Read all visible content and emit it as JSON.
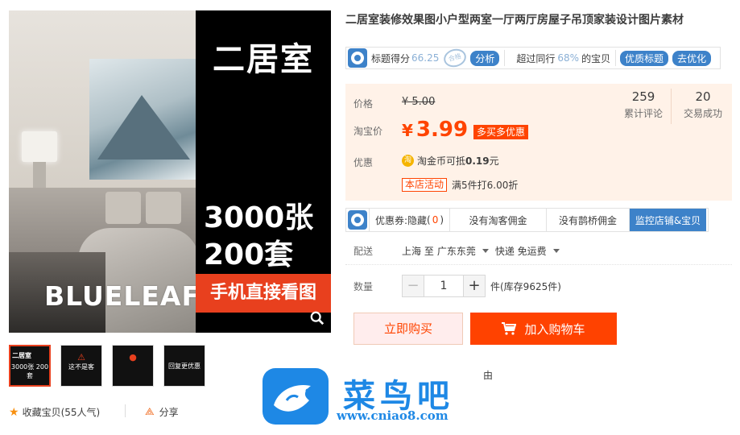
{
  "gallery": {
    "banner_title": "二居室",
    "banner_count1_num": "3000",
    "banner_count1_unit": "张",
    "banner_count2_num": "200",
    "banner_count2_unit": "套",
    "banner_cta": "手机直接看图",
    "brand": "BLUELEAF",
    "thumbs": [
      {
        "line1": "二居室",
        "line2": "3000张 200套"
      },
      {
        "line1": "这不是客"
      },
      {
        "line1": ""
      },
      {
        "line1": "回复更优惠"
      }
    ]
  },
  "footer_actions": {
    "favorite_label": "收藏宝贝",
    "favorite_count": "(55人气)",
    "share_label": "分享"
  },
  "product": {
    "title": "二居室装修效果图小户型两室一厅两厅房屋子吊顶家装设计图片素材"
  },
  "score_bar": {
    "label": "标题得分",
    "score": "66.25",
    "seal_text": "合格",
    "analyze": "分析",
    "exceed_prefix": "超过同行",
    "exceed_pct": "68%",
    "exceed_suffix": "的宝贝",
    "quality_title": "优质标题",
    "optimize": "去优化"
  },
  "price": {
    "price_label": "价格",
    "original": "¥ 5.00",
    "taobao_label": "淘宝价",
    "currency": "¥",
    "current": "3.99",
    "promo_tag": "多买多优惠",
    "discount_label": "优惠",
    "coin_icon": "淘",
    "coin_text": "淘金币可抵",
    "coin_amount": "0.19",
    "coin_unit": "元",
    "activity_tag": "本店活动",
    "activity_text": "满5件打6.00折",
    "reviews_count": "259",
    "reviews_label": "累计评论",
    "trades_count": "20",
    "trades_label": "交易成功"
  },
  "tabs": {
    "coupon_label": "优惠券:隐藏",
    "coupon_count": "0",
    "no_taoke": "没有淘客佣金",
    "no_queqiao": "没有鹊桥佣金",
    "monitor": "监控店铺&宝贝"
  },
  "delivery": {
    "label": "配送",
    "from": "上海 至",
    "to": "广东东莞",
    "method": "快递 免运费"
  },
  "quantity": {
    "label": "数量",
    "value": "1",
    "stock": "件(库存9625件)"
  },
  "buttons": {
    "buy_now": "立即购买",
    "add_to_cart": "加入购物车"
  },
  "partial_text": "由",
  "watermark": {
    "name": "菜鸟吧",
    "url": "www.cniao8.com"
  },
  "colors": {
    "accent": "#ff4400",
    "blue": "#3d82c9",
    "price_bg": "#fff2e8"
  }
}
